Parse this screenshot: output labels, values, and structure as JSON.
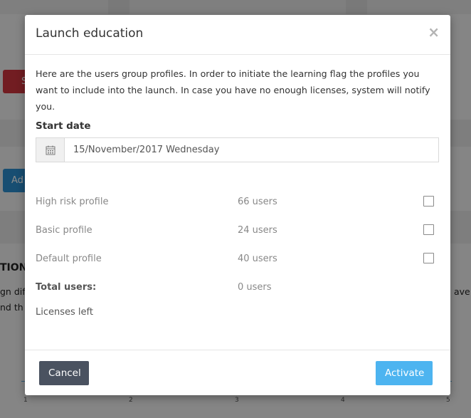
{
  "modal": {
    "title": "Launch education",
    "close_symbol": "×",
    "intro": "Here are the users group profiles. In order to initiate the learning flag the profiles you want to include into the launch. In case you have no enough licenses, system will notify you.",
    "start_date_label": "Start date",
    "start_date_value": "15/November/2017 Wednesday",
    "calendar_icon": "calendar-icon",
    "profiles": [
      {
        "name": "High risk profile",
        "count": "66 users",
        "checked": false
      },
      {
        "name": "Basic profile",
        "count": "24 users",
        "checked": false
      },
      {
        "name": "Default profile",
        "count": "40 users",
        "checked": false
      }
    ],
    "total_label": "Total users:",
    "total_value": "0 users",
    "licenses_label": "Licenses left",
    "cancel_label": "Cancel",
    "activate_label": "Activate"
  },
  "background": {
    "button_red_text": "S",
    "button_blue_text": "Ad",
    "heading_fragment": "TION I",
    "text_fragment_1": "gn diff",
    "text_fragment_2": "nd th",
    "text_fragment_right": "ave",
    "axis_ticks": [
      "1",
      "2",
      "3",
      "4",
      "5"
    ]
  },
  "colors": {
    "cancel_button": "#4a5260",
    "activate_button": "#4db4f0",
    "overlay": "rgba(0,0,0,0.45)"
  }
}
